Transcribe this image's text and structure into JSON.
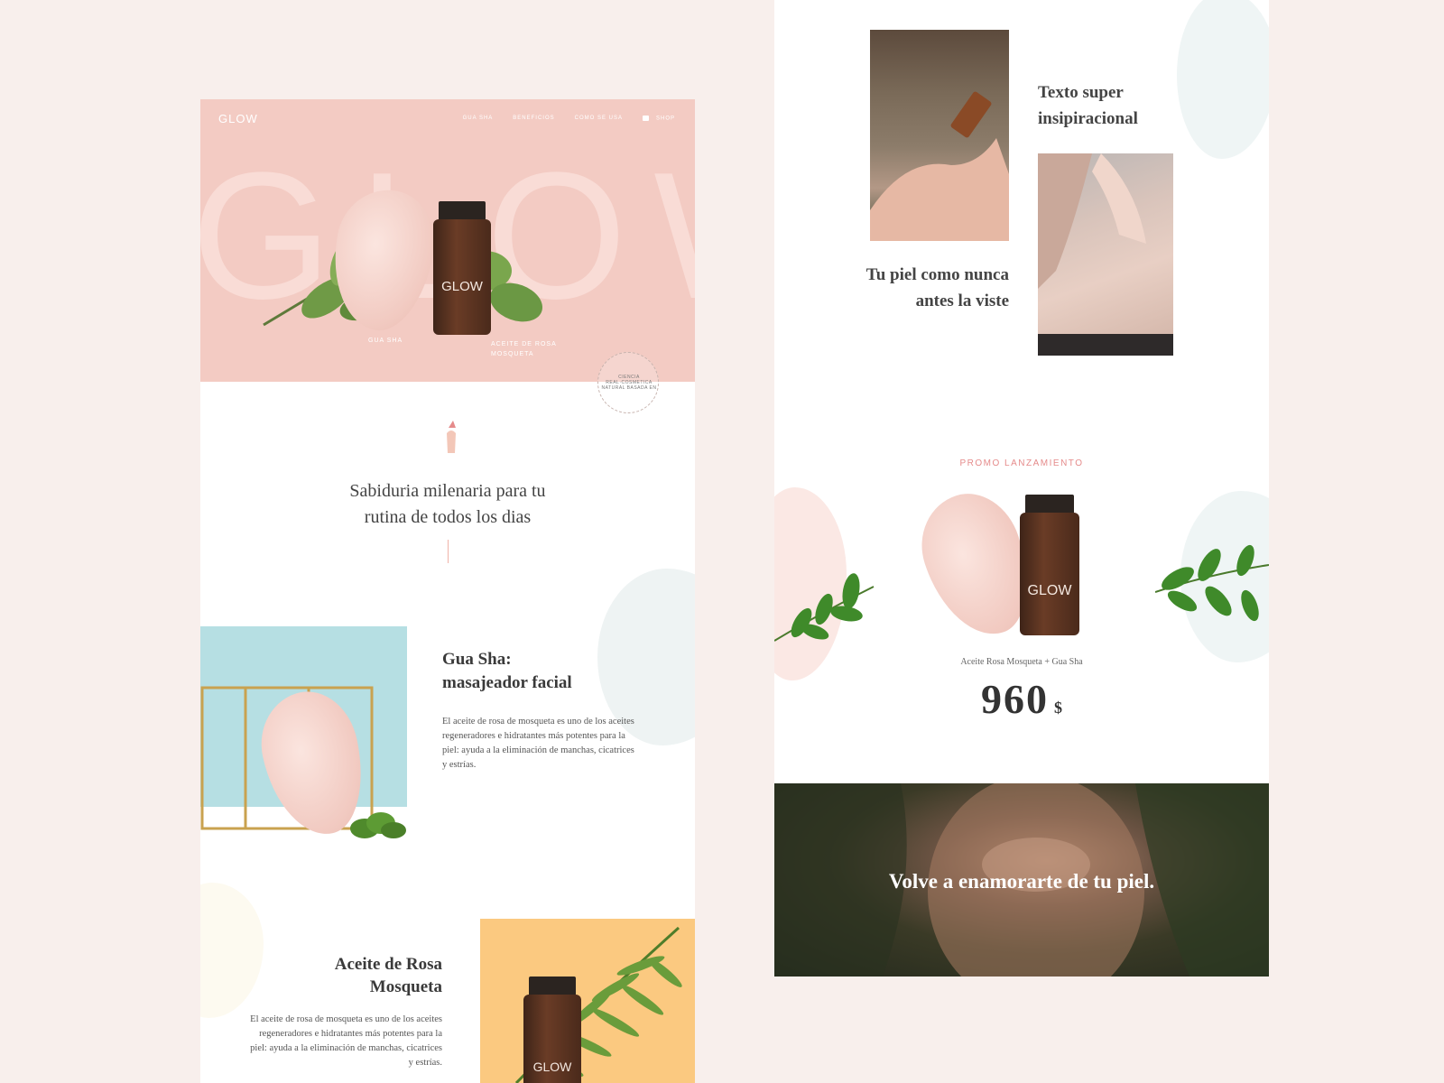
{
  "left": {
    "logo": "GLOW",
    "nav": [
      "GUA SHA",
      "BENEFICIOS",
      "COMO SE USA",
      "SHOP"
    ],
    "hero_bg_word": "GLOW",
    "bottle_brand": "GLOW",
    "hero_labels": {
      "gua_sha": "GUA SHA",
      "aceite_line1": "ACEITE DE ROSA",
      "aceite_line2": "MOSQUETA"
    },
    "stamp_text": "CIENCIA REAL·COSMETICA NATURAL BASADA EN",
    "tagline_line1": "Sabiduria milenaria para tu",
    "tagline_line2": "rutina de todos los dias",
    "guasha_section": {
      "title_line1": "Gua Sha:",
      "title_line2": "masajeador facial",
      "body": "El aceite de rosa de mosqueta es uno de los aceites regeneradores e hidratantes más potentes para la piel: ayuda a la eliminación de manchas, cicatrices y estrías."
    },
    "aceite_section": {
      "title_line1": "Aceite de Rosa",
      "title_line2": "Mosqueta",
      "body": "El aceite de rosa de mosqueta es uno de los aceites regeneradores e hidratantes más potentes para la piel: ayuda a la eliminación de manchas, cicatrices y estrías.",
      "bottle_brand": "GLOW"
    }
  },
  "right": {
    "quote1_line1": "Texto super",
    "quote1_line2": "insipiracional",
    "quote2_line1": "Tu piel como nunca",
    "quote2_line2": "antes la viste",
    "promo_label": "PROMO LANZAMIENTO",
    "bottle_brand": "GLOW",
    "price_caption": "Aceite Rosa Mosqueta + Gua Sha",
    "price_value": "960",
    "price_currency": "$",
    "banner_text": "Volve a enamorarte de tu piel."
  },
  "colors": {
    "page_bg": "#f8efec",
    "hero_pink": "#f3cbc3",
    "aqua": "#b6dfe3",
    "orange": "#fbc980",
    "promo_pink": "#e58b8b"
  }
}
